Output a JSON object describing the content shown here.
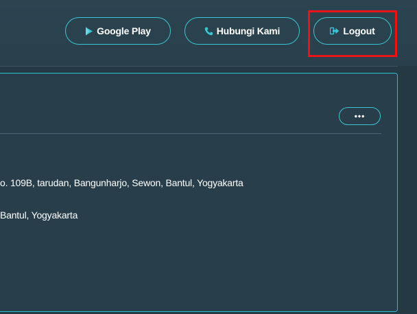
{
  "header": {
    "buttons": [
      {
        "label": "Google Play",
        "icon": "play-store-icon"
      },
      {
        "label": "Hubungi Kami",
        "icon": "phone-icon"
      },
      {
        "label": "Logout",
        "icon": "logout-icon"
      }
    ]
  },
  "card": {
    "more_label": "•••",
    "address_line": "o. 109B, tarudan, Bangunharjo, Sewon, Bantul, Yogyakarta",
    "city_line": "Bantul, Yogyakarta"
  },
  "colors": {
    "header_bg": "#2b4450",
    "main_bg": "#253944",
    "accent": "#3bc6d6",
    "highlight": "#e8141a"
  }
}
